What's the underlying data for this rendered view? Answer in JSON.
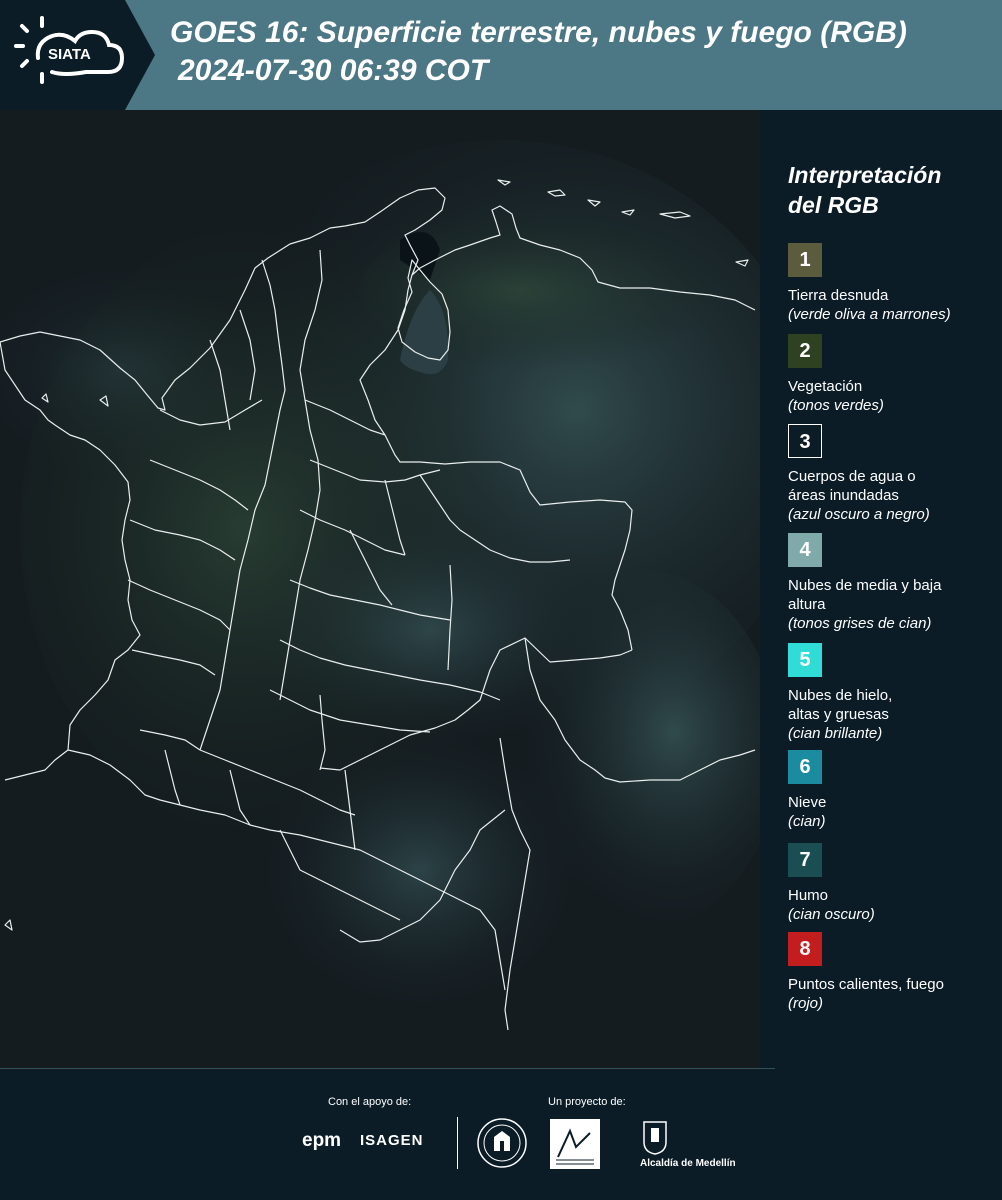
{
  "header": {
    "brand": "SIATA",
    "title_line1": "GOES 16: Superficie terrestre, nubes y fuego (RGB)",
    "title_line2": "2024-07-30 06:39 COT"
  },
  "legend": {
    "title_line1": "Interpretación",
    "title_line2": "del RGB",
    "items": [
      {
        "num": "1",
        "color": "#5b5b3e",
        "label": "Tierra desnuda",
        "sub": "(verde oliva a marrones)"
      },
      {
        "num": "2",
        "color": "#2e4222",
        "label": "Vegetación",
        "sub": "(tonos verdes)"
      },
      {
        "num": "3",
        "color": "#0b1c27",
        "label": "Cuerpos de agua o áreas inundadas",
        "sub": "(azul oscuro a negro)"
      },
      {
        "num": "4",
        "color": "#7faaa9",
        "label": "Nubes de media y baja altura",
        "sub": "(tonos grises de cian)"
      },
      {
        "num": "5",
        "color": "#2fdcd6",
        "label": "Nubes de hielo, altas y gruesas",
        "sub": "(cian brillante)"
      },
      {
        "num": "6",
        "color": "#1b8ba0",
        "label": "Nieve",
        "sub": "(cian)"
      },
      {
        "num": "7",
        "color": "#1b4e52",
        "label": "Humo",
        "sub": "(cian oscuro)"
      },
      {
        "num": "8",
        "color": "#c41d1d",
        "label": "Puntos calientes, fuego",
        "sub": "(rojo)"
      }
    ]
  },
  "footer": {
    "support_label": "Con el apoyo de:",
    "project_label": "Un proyecto de:",
    "sponsor1": "epm",
    "sponsor2": "ISAGEN",
    "partner3": "Alcaldía de Medellín"
  }
}
